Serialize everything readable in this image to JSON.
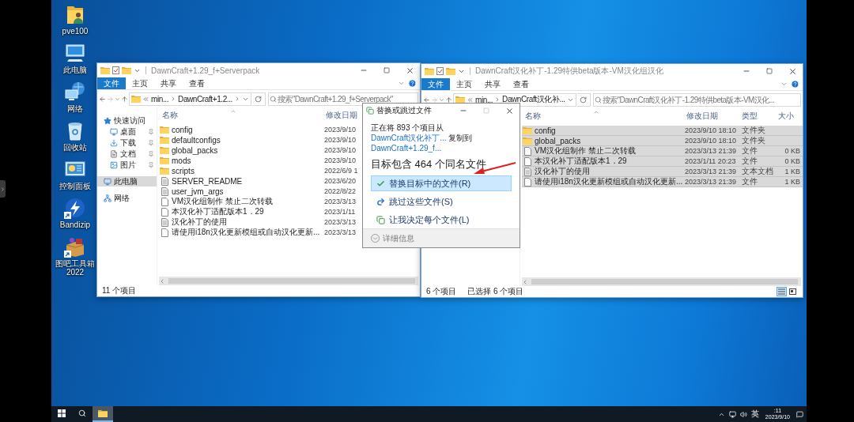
{
  "desktop_icons": [
    {
      "label": "pve100",
      "kind": "user-folder",
      "shortcut": false
    },
    {
      "label": "此电脑",
      "kind": "computer",
      "shortcut": false
    },
    {
      "label": "网络",
      "kind": "network",
      "shortcut": false
    },
    {
      "label": "回收站",
      "kind": "recycle-bin",
      "shortcut": false
    },
    {
      "label": "控制面板",
      "kind": "control-panel",
      "shortcut": false
    },
    {
      "label": "Bandizip",
      "kind": "bandizip",
      "shortcut": true
    },
    {
      "label": "图吧工具箱 2022",
      "kind": "toolbox",
      "shortcut": true
    }
  ],
  "windows": [
    {
      "title": "DawnCraft+1.29_f+Serverpack",
      "ribbon_tabs": [
        {
          "label": "文件",
          "kind": "file"
        },
        {
          "label": "主页",
          "kind": "tab"
        },
        {
          "label": "共享",
          "kind": "tab"
        },
        {
          "label": "查看",
          "kind": "tab"
        }
      ],
      "address": [
        "min...",
        "DawnCraft+1.2..."
      ],
      "trailing_chevron": true,
      "search": {
        "placeholder": "搜索\"DawnCraft+1.29_f+Serverpack\""
      },
      "nav": [
        {
          "label": "快速访问",
          "kind": "star",
          "selected": false,
          "children": [
            {
              "label": "桌面",
              "kind": "desktop",
              "pinned": true,
              "selected": false
            },
            {
              "label": "下载",
              "kind": "download",
              "pinned": true,
              "selected": false
            },
            {
              "label": "文档",
              "kind": "document",
              "pinned": true,
              "selected": false
            },
            {
              "label": "图片",
              "kind": "pictures",
              "pinned": true,
              "selected": false
            }
          ]
        },
        {
          "label": "此电脑",
          "kind": "pc",
          "selected": true
        },
        {
          "label": "网络",
          "kind": "network",
          "selected": false
        }
      ],
      "columns": [
        "名称",
        "修改日期"
      ],
      "rows": [
        {
          "name": "config",
          "kind": "folder",
          "date": "2023/9/10",
          "selected": false
        },
        {
          "name": "defaultconfigs",
          "kind": "folder",
          "date": "2023/9/10",
          "selected": false
        },
        {
          "name": "global_packs",
          "kind": "folder",
          "date": "2023/9/10",
          "selected": false
        },
        {
          "name": "mods",
          "kind": "folder",
          "date": "2023/9/10",
          "selected": false
        },
        {
          "name": "scripts",
          "kind": "folder",
          "date": "2022/6/9 1",
          "selected": false
        },
        {
          "name": "SERVER_README",
          "kind": "doc",
          "date": "2023/6/20",
          "selected": false
        },
        {
          "name": "user_jvm_args",
          "kind": "doc",
          "date": "2022/8/22",
          "selected": false
        },
        {
          "name": "VM汉化组制作 禁止二次转载",
          "kind": "file",
          "date": "2023/3/13",
          "selected": false
        },
        {
          "name": "本汉化补丁适配版本1．29",
          "kind": "file",
          "date": "2023/1/11",
          "selected": false
        },
        {
          "name": "汉化补丁的使用",
          "kind": "doc",
          "date": "2023/3/13",
          "selected": false
        },
        {
          "name": "请使用i18n汉化更新模组或自动汉化更新...",
          "kind": "file",
          "date": "2023/3/13",
          "selected": false
        }
      ],
      "status": [
        "11 个项目"
      ]
    },
    {
      "title": "DawnCraft汉化补丁-1.29特供beta版本-VM汉化组汉化",
      "ribbon_tabs": [
        {
          "label": "文件",
          "kind": "file"
        },
        {
          "label": "主页",
          "kind": "tab"
        },
        {
          "label": "共享",
          "kind": "tab"
        },
        {
          "label": "查看",
          "kind": "tab"
        }
      ],
      "address": [
        "min...",
        "DawnCraft汉化补..."
      ],
      "trailing_chevron": false,
      "search": {
        "placeholder": "搜索\"DawnCraft汉化补丁-1.29特供beta版本-VM汉化..."
      },
      "columns": [
        "名称",
        "修改日期",
        "类型",
        "大小"
      ],
      "rows": [
        {
          "name": "config",
          "kind": "folder",
          "date": "2023/9/10 18:10",
          "type": "文件夹",
          "selected": true
        },
        {
          "name": "global_packs",
          "kind": "folder",
          "date": "2023/9/10 18:10",
          "type": "文件夹",
          "selected": true
        },
        {
          "name": "VM汉化组制作 禁止二次转载",
          "kind": "file",
          "date": "2023/3/13 21:39",
          "type": "文件",
          "size": "0 KB",
          "selected": true
        },
        {
          "name": "本汉化补丁适配版本1．29",
          "kind": "file",
          "date": "2023/1/11 20:23",
          "type": "文件",
          "size": "0 KB",
          "selected": true
        },
        {
          "name": "汉化补丁的使用",
          "kind": "doc",
          "date": "2023/3/13 21:39",
          "type": "文本文档",
          "size": "1 KB",
          "selected": true
        },
        {
          "name": "请使用i18n汉化更新模组或自动汉化更新...",
          "kind": "file",
          "date": "2023/3/13 21:39",
          "type": "文件",
          "size": "1 KB",
          "selected": true
        }
      ],
      "status": [
        "6 个项目",
        "已选择 6 个项目"
      ],
      "view_buttons": [
        {
          "kind": "details",
          "selected": true
        },
        {
          "kind": "thumbnails",
          "selected": false
        }
      ]
    }
  ],
  "dialog": {
    "title": "替换或跳过文件",
    "message": [
      {
        "text": "正在将 893 个项目从",
        "kind": "text"
      },
      {
        "text": "DawnCraft汉化补丁...",
        "kind": "link"
      },
      {
        "text": "复制到",
        "kind": "text"
      },
      {
        "text": "DawnCraft+1.29_f...",
        "kind": "link"
      }
    ],
    "heading": "目标包含 464 个同名文件",
    "options": [
      {
        "label": "替换目标中的文件(R)",
        "kind": "replace",
        "selected": true
      },
      {
        "label": "跳过这些文件(S)",
        "kind": "skip",
        "selected": false
      },
      {
        "label": "让我决定每个文件(L)",
        "kind": "decide",
        "selected": false
      }
    ],
    "details": "详细信息"
  },
  "taskbar": {
    "apps": [
      {
        "kind": "explorer",
        "selected": true
      }
    ],
    "ime": "英",
    "time": ":11",
    "date": "2023/9/10"
  }
}
